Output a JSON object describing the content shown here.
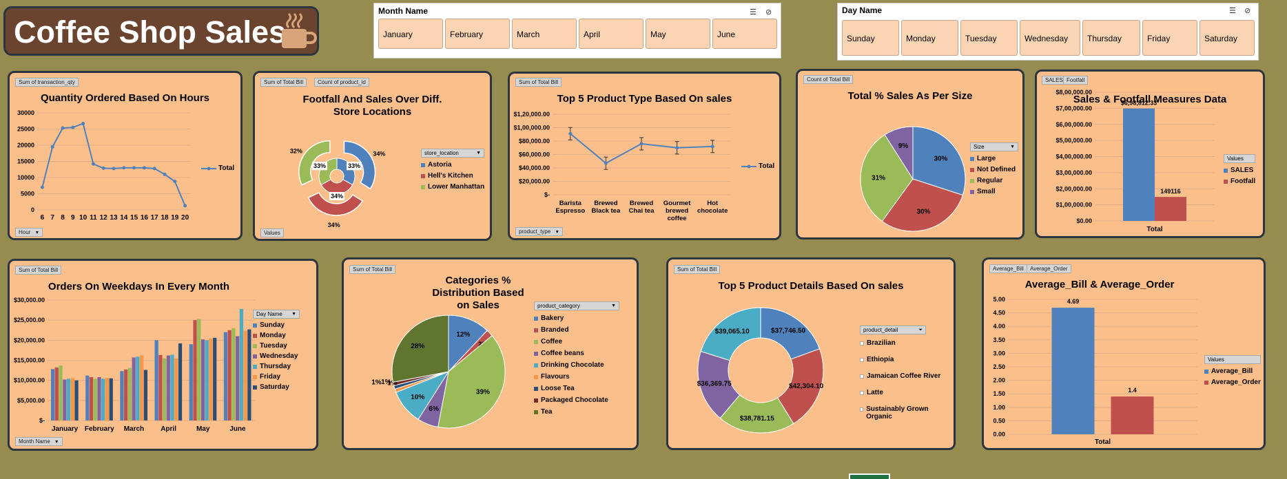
{
  "header": {
    "title": "Coffee Shop Sales"
  },
  "month_slicer": {
    "title": "Month Name",
    "items": [
      "January",
      "February",
      "March",
      "April",
      "May",
      "June"
    ]
  },
  "day_slicer": {
    "title": "Day Name",
    "items": [
      "Sunday",
      "Monday",
      "Tuesday",
      "Wednesday",
      "Thursday",
      "Friday",
      "Saturday"
    ]
  },
  "charts": {
    "hours": {
      "field": "Sum of transaction_qty",
      "axis_btn": "Hour",
      "legend": "Total"
    },
    "footfall": {
      "fields": [
        "Sum of Total Bill",
        "Count of product_id"
      ],
      "legend_hdr": "store_location",
      "values_btn": "Values"
    },
    "product_type": {
      "field": "Sum of Total Bill",
      "axis_btn": "product_type",
      "legend": "Total"
    },
    "size": {
      "field": "Count of Total Bill",
      "legend_hdr": "Size"
    },
    "measures": {
      "fields": [
        "SALES",
        "Footfall"
      ],
      "legend_hdr": "Values",
      "x_label": "Total"
    },
    "weekdays": {
      "field": "Sum of Total Bill",
      "axis_btn": "Month Name",
      "legend_hdr": "Day Name"
    },
    "categories": {
      "field": "Sum of Total Bill",
      "legend_hdr": "product_category"
    },
    "details": {
      "field": "Sum of Total Bill",
      "legend_hdr": "product_detail"
    },
    "avg": {
      "fields": [
        "Average_Bill",
        "Average_Order"
      ],
      "legend_hdr": "Values",
      "x_label": "Total"
    }
  },
  "colors": {
    "blue": "#4f81bd",
    "red": "#c0504d",
    "green": "#9bbb59",
    "purple": "#8064a2",
    "aqua": "#4bacc6",
    "orange": "#f79646",
    "navy": "#2c4d75",
    "maroon": "#772c2a",
    "olive": "#5f7530"
  },
  "chart_data": [
    {
      "id": "hours",
      "type": "line",
      "title": "Quantity Ordered Based On Hours",
      "categories": [
        "6",
        "7",
        "8",
        "9",
        "10",
        "11",
        "12",
        "13",
        "14",
        "15",
        "16",
        "17",
        "18",
        "19",
        "20"
      ],
      "series": [
        {
          "name": "Total",
          "values": [
            7000,
            19500,
            25300,
            25500,
            26700,
            14200,
            12900,
            12800,
            13000,
            13000,
            13000,
            12800,
            11000,
            8800,
            1300
          ]
        }
      ],
      "ylim": [
        0,
        30000
      ],
      "yticks": [
        "0",
        "5000",
        "10000",
        "15000",
        "20000",
        "25000",
        "30000"
      ]
    },
    {
      "id": "footfall",
      "type": "pie",
      "title": "Footfall And Sales Over Diff. Store Locations",
      "categories": [
        "Astoria",
        "Hell's Kitchen",
        "Lower Manhattan"
      ],
      "outer_labels": [
        "34%",
        "34%",
        "32%"
      ],
      "inner_labels": [
        "33%",
        "34%",
        "33%"
      ]
    },
    {
      "id": "product_type",
      "type": "line",
      "title": "Top 5 Product Type Based On sales",
      "categories": [
        "Barista Espresso",
        "Brewed Black tea",
        "Brewed Chai tea",
        "Gourmet brewed coffee",
        "Hot chocolate"
      ],
      "series": [
        {
          "name": "Total",
          "values": [
            91000,
            47000,
            76000,
            70000,
            72000
          ]
        }
      ],
      "ylim": [
        0,
        120000
      ],
      "yticks": [
        "$-",
        "$20,000.00",
        "$40,000.00",
        "$60,000.00",
        "$80,000.00",
        "$1,00,000.00",
        "$1,20,000.00"
      ]
    },
    {
      "id": "size",
      "type": "pie",
      "title": "Total % Sales As Per Size",
      "categories": [
        "Large",
        "Not Defined",
        "Regular",
        "Small"
      ],
      "values": [
        30,
        30,
        31,
        9
      ],
      "labels": [
        "30%",
        "30%",
        "31%",
        "9%"
      ]
    },
    {
      "id": "measures",
      "type": "bar",
      "title": "Sales & Footfall Measures Data",
      "categories": [
        "Total"
      ],
      "series": [
        {
          "name": "SALES",
          "values": [
            698812.33
          ],
          "label": "$6,98,812.33"
        },
        {
          "name": "Footfall",
          "values": [
            149116
          ],
          "label": "149116"
        }
      ],
      "ylim": [
        0,
        800000
      ],
      "yticks": [
        "$0.00",
        "$1,00,000.00",
        "$2,00,000.00",
        "$3,00,000.00",
        "$4,00,000.00",
        "$5,00,000.00",
        "$6,00,000.00",
        "$7,00,000.00",
        "$8,00,000.00"
      ]
    },
    {
      "id": "weekdays",
      "type": "bar",
      "title": "Orders On Weekdays In Every Month",
      "categories": [
        "January",
        "February",
        "March",
        "April",
        "May",
        "June"
      ],
      "series": [
        {
          "name": "Sunday",
          "values": [
            12800,
            11200,
            12300,
            20000,
            19000,
            22000
          ]
        },
        {
          "name": "Monday",
          "values": [
            13200,
            10800,
            12700,
            16300,
            25000,
            22500
          ]
        },
        {
          "name": "Tuesday",
          "values": [
            13700,
            10400,
            13100,
            15500,
            25300,
            23000
          ]
        },
        {
          "name": "Wednesday",
          "values": [
            10200,
            10800,
            15700,
            16200,
            20200,
            21000
          ]
        },
        {
          "name": "Thursday",
          "values": [
            10400,
            10400,
            15900,
            16400,
            20000,
            27800
          ]
        },
        {
          "name": "Friday",
          "values": [
            10500,
            10600,
            16200,
            15500,
            20400,
            22400
          ]
        },
        {
          "name": "Saturday",
          "values": [
            10000,
            10500,
            12600,
            19200,
            20600,
            22700
          ]
        }
      ],
      "ylim": [
        0,
        30000
      ],
      "yticks": [
        "$-",
        "$5,000.00",
        "$10,000.00",
        "$15,000.00",
        "$20,000.00",
        "$25,000.00",
        "$30,000.00"
      ]
    },
    {
      "id": "categories",
      "type": "pie",
      "title": "Categories % Distribution Based on Sales",
      "categories": [
        "Bakery",
        "Branded",
        "Coffee",
        "Coffee beans",
        "Drinking Chocolate",
        "Flavours",
        "Loose Tea",
        "Packaged Chocolate",
        "Tea"
      ],
      "values": [
        12,
        2,
        39,
        6,
        10,
        1,
        1,
        1,
        28
      ],
      "labels": [
        "12%",
        "2%",
        "39%",
        "6%",
        "10%",
        "1%",
        "1%",
        "1%",
        "28%"
      ]
    },
    {
      "id": "details",
      "type": "pie",
      "title": "Top 5 Product Details Based On sales",
      "categories": [
        "Brazilian",
        "Ethiopia",
        "Jamaican Coffee River",
        "Latte",
        "Sustainably Grown Organic"
      ],
      "values": [
        37746.5,
        42304.1,
        38781.15,
        36369.75,
        39065.1
      ],
      "labels": [
        "$37,746.50",
        "$42,304.10",
        "$38,781.15",
        "$36,369.75",
        "$39,065.10"
      ]
    },
    {
      "id": "avg",
      "type": "bar",
      "title": "Average_Bill & Average_Order",
      "categories": [
        "Total"
      ],
      "series": [
        {
          "name": "Average_Bill",
          "values": [
            4.69
          ],
          "label": "4.69"
        },
        {
          "name": "Average_Order",
          "values": [
            1.4
          ],
          "label": "1.4"
        }
      ],
      "ylim": [
        0,
        5
      ],
      "yticks": [
        "0.00",
        "0.50",
        "1.00",
        "1.50",
        "2.00",
        "2.50",
        "3.00",
        "3.50",
        "4.00",
        "4.50",
        "5.00"
      ]
    }
  ]
}
